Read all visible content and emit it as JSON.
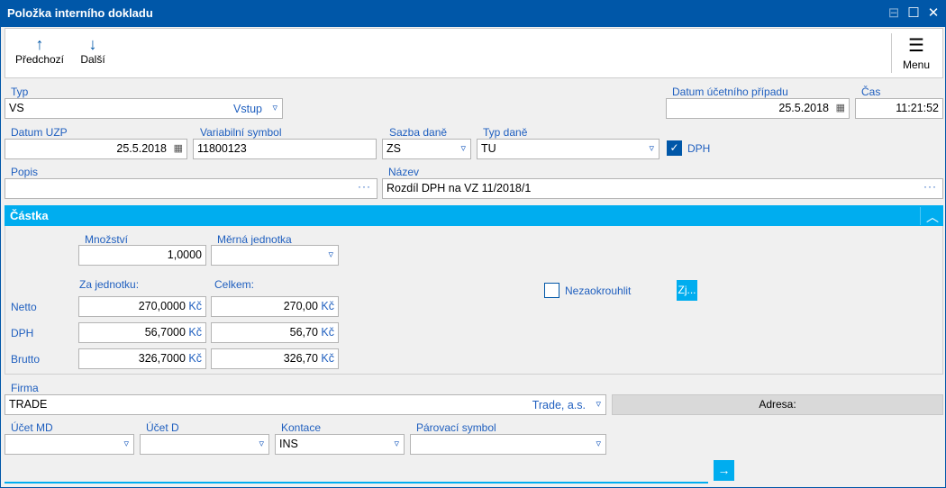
{
  "window": {
    "title": "Položka interního dokladu"
  },
  "toolbar": {
    "prev": "Předchozí",
    "next": "Další",
    "menu": "Menu"
  },
  "fields": {
    "typ": {
      "label": "Typ",
      "value": "VS",
      "text": "Vstup"
    },
    "datum_up": {
      "label": "Datum účetního případu",
      "value": "25.5.2018"
    },
    "cas": {
      "label": "Čas",
      "value": "11:21:52"
    },
    "datum_uzp": {
      "label": "Datum UZP",
      "value": "25.5.2018"
    },
    "var_symbol": {
      "label": "Variabilní symbol",
      "value": "11800123"
    },
    "sazba": {
      "label": "Sazba daně",
      "value": "ZS"
    },
    "typ_dane": {
      "label": "Typ daně",
      "value": "TU"
    },
    "dph_check": {
      "label": "DPH",
      "checked": true
    },
    "popis": {
      "label": "Popis",
      "value": ""
    },
    "nazev": {
      "label": "Název",
      "value": "Rozdíl DPH na VZ 11/2018/1"
    }
  },
  "castka": {
    "title": "Částka",
    "mnozstvi": {
      "label": "Množství",
      "value": "1,0000"
    },
    "mj": {
      "label": "Měrná jednotka",
      "value": ""
    },
    "col_unit": "Za jednotku:",
    "col_total": "Celkem:",
    "currency": "Kč",
    "rows": [
      {
        "label": "Netto",
        "unit": "270,0000",
        "total": "270,00"
      },
      {
        "label": "DPH",
        "unit": "56,7000",
        "total": "56,70"
      },
      {
        "label": "Brutto",
        "unit": "326,7000",
        "total": "326,70"
      }
    ],
    "nezaokrouhlit": {
      "label": "Nezaokrouhlit",
      "checked": false
    },
    "zj_button": "Zj..."
  },
  "firma": {
    "label": "Firma",
    "value": "TRADE",
    "text": "Trade, a.s.",
    "address_button": "Adresa:"
  },
  "accounts": {
    "ucet_md": {
      "label": "Účet MD",
      "value": ""
    },
    "ucet_d": {
      "label": "Účet D",
      "value": ""
    },
    "kontace": {
      "label": "Kontace",
      "value": "INS"
    },
    "parovaci": {
      "label": "Párovací symbol",
      "value": ""
    }
  },
  "colors": {
    "titlebar": "#0057a8",
    "accent": "#00adef",
    "label": "#1f5fbf"
  }
}
